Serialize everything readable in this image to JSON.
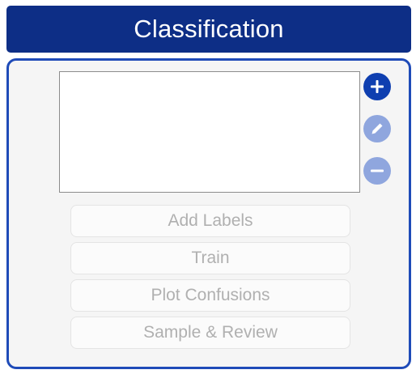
{
  "header": {
    "title": "Classification"
  },
  "labels_list": {
    "items": []
  },
  "side_buttons": {
    "add": {
      "icon": "plus-icon",
      "color": "#0f3fb0",
      "enabled": true
    },
    "edit": {
      "icon": "pencil-icon",
      "color": "#8fa6de",
      "enabled": false
    },
    "remove": {
      "icon": "minus-icon",
      "color": "#8fa6de",
      "enabled": false
    }
  },
  "actions": {
    "add_labels": "Add Labels",
    "train": "Train",
    "plot_confusions": "Plot Confusions",
    "sample_review": "Sample & Review"
  },
  "colors": {
    "header_bg": "#0d2e86",
    "panel_border": "#1f4bb8",
    "disabled_text": "#b0b0b0"
  }
}
